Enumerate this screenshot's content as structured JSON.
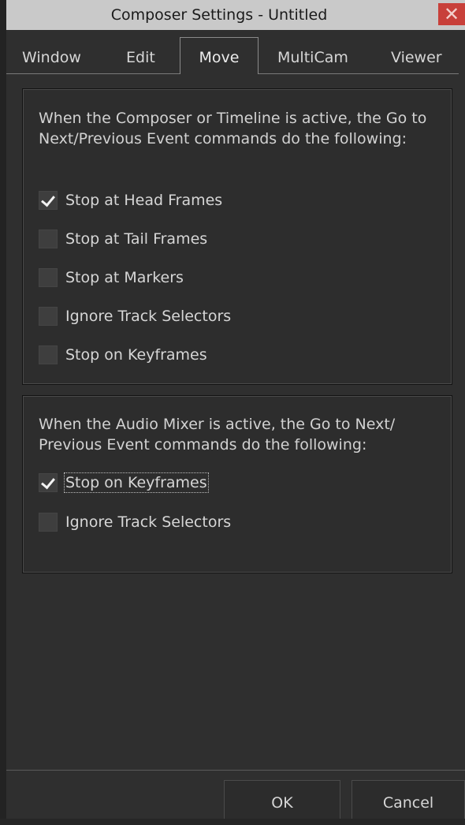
{
  "window": {
    "title": "Composer Settings - Untitled",
    "close_glyph": "✕"
  },
  "tabs": [
    {
      "label": "Window",
      "active": false
    },
    {
      "label": "Edit",
      "active": false
    },
    {
      "label": "Move",
      "active": true
    },
    {
      "label": "MultiCam",
      "active": false
    },
    {
      "label": "Viewer",
      "active": false
    }
  ],
  "composer_group": {
    "description": "When the Composer or Timeline is active, the Go to Next/Previous Event commands do the following:",
    "options": [
      {
        "label": "Stop at Head Frames",
        "checked": true
      },
      {
        "label": "Stop at Tail Frames",
        "checked": false
      },
      {
        "label": "Stop at Markers",
        "checked": false
      },
      {
        "label": "Ignore Track Selectors",
        "checked": false
      },
      {
        "label": "Stop on Keyframes",
        "checked": false
      }
    ]
  },
  "audio_group": {
    "description": "When the Audio Mixer is active, the Go to Next/ Previous Event commands do the following:",
    "options": [
      {
        "label": "Stop on Keyframes",
        "checked": true,
        "focused": true
      },
      {
        "label": "Ignore Track Selectors",
        "checked": false
      }
    ]
  },
  "buttons": {
    "ok_label": "OK",
    "cancel_label": "Cancel"
  },
  "colors": {
    "background": "#2f2f2f",
    "titlebar": "#c9c9c9",
    "close": "#c8403a"
  }
}
